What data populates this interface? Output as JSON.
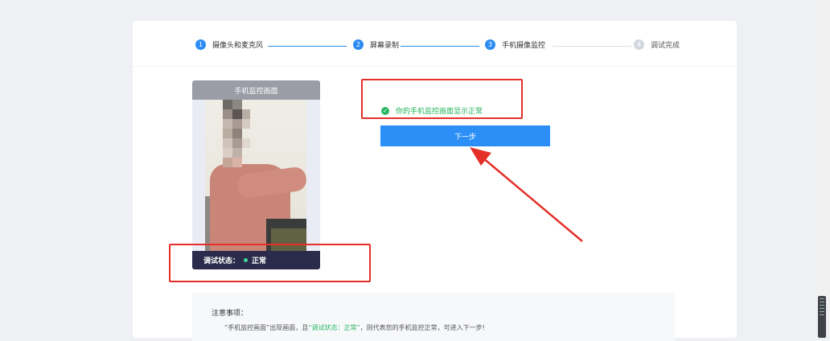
{
  "steps": [
    {
      "number": "1",
      "label": "摄像头和麦克风",
      "status": "done"
    },
    {
      "number": "2",
      "label": "屏幕录制",
      "status": "done"
    },
    {
      "number": "3",
      "label": "手机摄像监控",
      "status": "current"
    },
    {
      "number": "4",
      "label": "调试完成",
      "status": "pending"
    }
  ],
  "camera": {
    "title": "手机监控画面",
    "status_label": "调试状态：",
    "status_value": "正常"
  },
  "message": "你的手机监控画面显示正常",
  "next_button": "下一步",
  "notice": {
    "title": "注意事项：",
    "desc_prefix": "“手机监控画面”出现画面，且",
    "desc_highlight": "“调试状态：正常”",
    "desc_suffix": "，则代表您的手机监控正常，可进入下一步!"
  },
  "colors": {
    "primary": "#2b8ff7",
    "success": "#26b35a",
    "annotation": "#e5302a",
    "status_bar": "#2b2c4b"
  }
}
